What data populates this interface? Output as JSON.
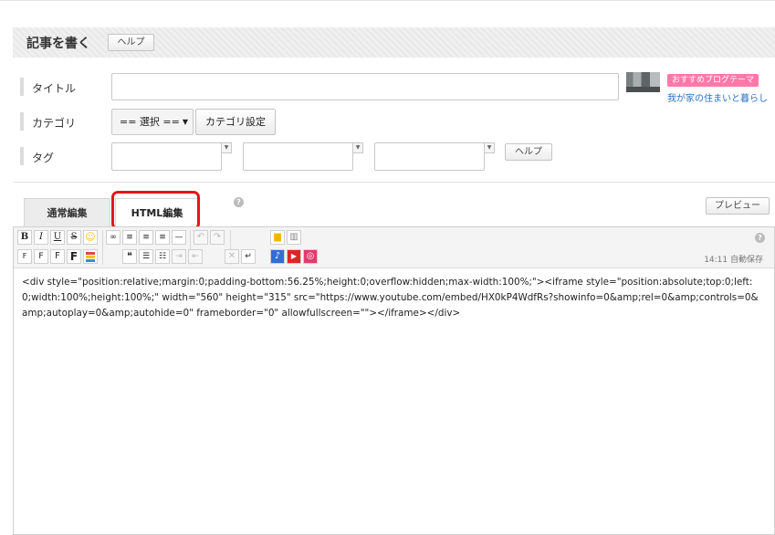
{
  "header": {
    "title": "記事を書く",
    "help_label": "ヘルプ"
  },
  "fields": {
    "title_label": "タイトル",
    "category_label": "カテゴリ",
    "category_select": "== 選択 ==",
    "category_settings": "カテゴリ設定",
    "tag_label": "タグ",
    "tag_help": "ヘルプ"
  },
  "recommend": {
    "badge": "おすすめブログテーマ",
    "link": "我が家の住まいと暮らし"
  },
  "tabs": {
    "normal": "通常編集",
    "html": "HTML編集"
  },
  "preview_label": "プレビュー",
  "toolbar": {
    "row1": [
      {
        "icon": "bold-icon",
        "glyph": "B"
      },
      {
        "icon": "italic-icon",
        "glyph": "I"
      },
      {
        "icon": "underline-icon",
        "glyph": "U"
      },
      {
        "icon": "strikethrough-icon",
        "glyph": "S"
      },
      {
        "icon": "emoji-icon",
        "glyph": "☺"
      },
      {
        "icon": "link-icon",
        "glyph": "🔗"
      },
      {
        "icon": "align-left-icon",
        "glyph": "≡"
      },
      {
        "icon": "align-center-icon",
        "glyph": "≡"
      },
      {
        "icon": "align-right-icon",
        "glyph": "≡"
      },
      {
        "icon": "horizontal-rule-icon",
        "glyph": "—"
      },
      {
        "icon": "undo-icon",
        "glyph": "↶"
      },
      {
        "icon": "redo-icon",
        "glyph": "↷"
      },
      {
        "icon": "folder-icon",
        "glyph": "▆"
      },
      {
        "icon": "book-icon",
        "glyph": "▥"
      }
    ],
    "row2": [
      {
        "icon": "font-size-small-icon",
        "glyph": "F"
      },
      {
        "icon": "font-size-medium-icon",
        "glyph": "F"
      },
      {
        "icon": "font-size-large-icon",
        "glyph": "F"
      },
      {
        "icon": "font-size-xlarge-icon",
        "glyph": "F"
      },
      {
        "icon": "text-color-icon",
        "glyph": "≡"
      },
      {
        "icon": "quote-icon",
        "glyph": "❝"
      },
      {
        "icon": "bullet-list-icon",
        "glyph": "☰"
      },
      {
        "icon": "numbered-list-icon",
        "glyph": "☷"
      },
      {
        "icon": "indent-icon",
        "glyph": "⇥"
      },
      {
        "icon": "outdent-icon",
        "glyph": "⇤"
      },
      {
        "icon": "clear-format-icon",
        "glyph": "✕"
      },
      {
        "icon": "auto-linebreak-icon",
        "glyph": "↵"
      },
      {
        "icon": "music-icon",
        "glyph": "♪"
      },
      {
        "icon": "youtube-icon",
        "glyph": "▶"
      },
      {
        "icon": "instagram-icon",
        "glyph": "◎"
      }
    ],
    "colors": {
      "emoji": "#f6c400",
      "link": "#444444",
      "folder": "#f2b600",
      "music": "#2f6fd6",
      "youtube": "#e02424",
      "instagram": "#e23a6c",
      "text_color_top": "#e8453c",
      "text_color_mid": "#f6c400",
      "text_color_bot": "#2f8fdc"
    }
  },
  "autosave": "14:11 自動保存",
  "editor": {
    "content": "<div style=\"position:relative;margin:0;padding-bottom:56.25%;height:0;overflow:hidden;max-width:100%;\"><iframe style=\"position:absolute;top:0;left:0;width:100%;height:100%;\" width=\"560\" height=\"315\" src=\"https://www.youtube.com/embed/HX0kP4WdfRs?showinfo=0&amp;rel=0&amp;controls=0&amp;autoplay=0&amp;autohide=0\" frameborder=\"0\" allowfullscreen=\"\"></iframe></div>"
  }
}
